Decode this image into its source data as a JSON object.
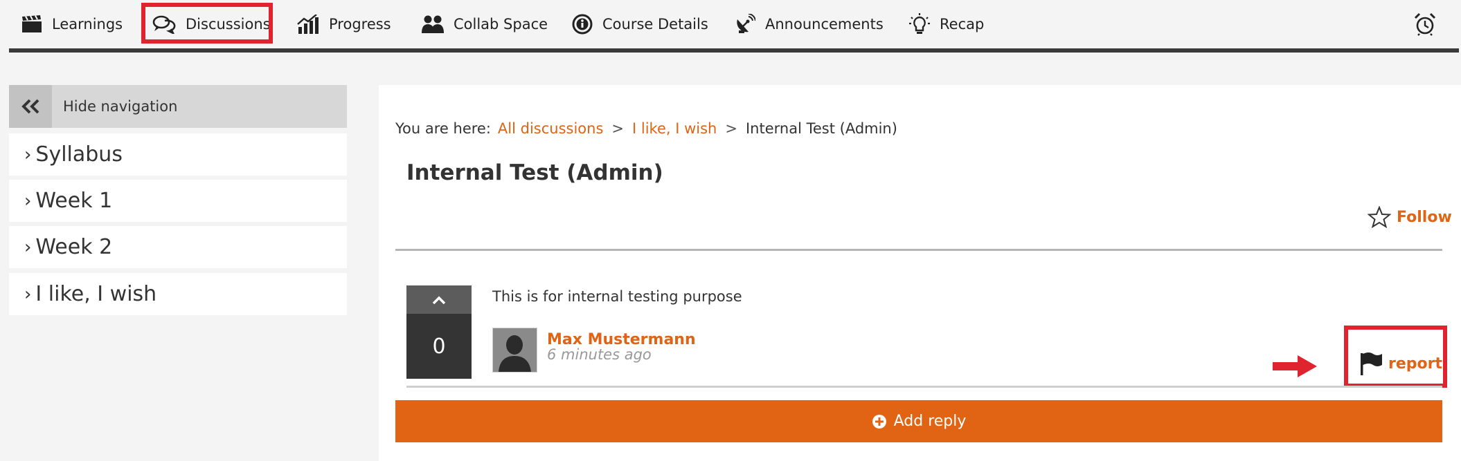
{
  "nav": {
    "items": [
      {
        "label": "Learnings",
        "icon": "clapperboard-icon"
      },
      {
        "label": "Discussions",
        "icon": "chat-bubbles-icon"
      },
      {
        "label": "Progress",
        "icon": "bar-chart-icon"
      },
      {
        "label": "Collab Space",
        "icon": "users-icon"
      },
      {
        "label": "Course Details",
        "icon": "info-icon"
      },
      {
        "label": "Announcements",
        "icon": "satellite-dish-icon"
      },
      {
        "label": "Recap",
        "icon": "lightbulb-icon"
      }
    ],
    "alarm_icon": "alarm-clock-icon",
    "highlight_color": "#e0242f"
  },
  "sidebar": {
    "hide_label": "Hide navigation",
    "items": [
      {
        "label": "Syllabus"
      },
      {
        "label": "Week 1"
      },
      {
        "label": "Week 2"
      },
      {
        "label": "I like, I wish"
      }
    ]
  },
  "breadcrumb": {
    "prefix": "You are here:",
    "links": [
      "All discussions",
      "I like, I wish"
    ],
    "separator": ">",
    "current": "Internal Test (Admin)"
  },
  "thread": {
    "title": "Internal Test (Admin)",
    "follow_label": "Follow"
  },
  "post": {
    "votes": "0",
    "text": "This is for internal testing purpose",
    "author": "Max Mustermann",
    "time": "6 minutes ago",
    "report_label": "report"
  },
  "actions": {
    "add_reply_label": "Add reply"
  },
  "colors": {
    "accent": "#e06414",
    "annotation_red": "#e0242f"
  }
}
